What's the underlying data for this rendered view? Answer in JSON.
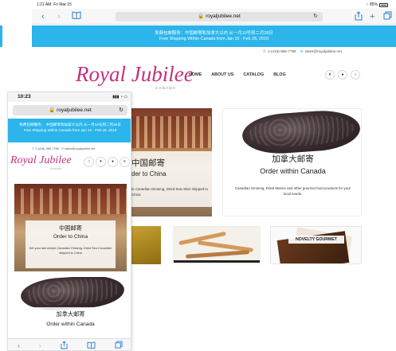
{
  "tablet": {
    "status": {
      "time": "1:21 AM",
      "date": "Fri Mar 15",
      "battery": "85%"
    },
    "toolbar": {
      "back_icon": "chevron-left-icon",
      "forward_icon": "chevron-right-icon",
      "bookmarks_icon": "book-icon",
      "url": "🔒 royaljubilee.net",
      "reload_icon": "reload-icon",
      "share_icon": "share-icon",
      "add_tab_icon": "plus-icon",
      "tabs_icon": "tabs-icon"
    },
    "banner": {
      "line1": "免费包邮服务：中国邮寄和加拿大以内 从一月10号到二月28日",
      "line2": "Free Shipping Within Canada from Jan 10 - Feb 28, 2019"
    },
    "contact": {
      "phone": "1-(416)-986-7788",
      "email": "sales@royaljubilee.net"
    },
    "logo": {
      "script": "Royal Jubilee",
      "sub": "CANADA"
    },
    "nav": [
      "HOME",
      "ABOUT US",
      "CATALOG",
      "BLOG"
    ],
    "cards": [
      {
        "title": "中国邮寄",
        "subtitle": "der to China",
        "desc": "te Canadian Ginseng, Dried Sea mber  shipped to China"
      },
      {
        "title": "加拿大邮寄",
        "subtitle": "Order within Canada",
        "desc": "Canadian Ginseng, Dried Marine and other gourmet food products for your local needs."
      }
    ],
    "products": {
      "gourmet_label": "NOVELTY GOURMET"
    }
  },
  "phone": {
    "status": {
      "time": "10:23"
    },
    "url": "🔒 royaljubilee.net",
    "banner": {
      "line1": "免费包邮服务：  中国邮寄和加拿大以内 从一月10号到二月28日",
      "line2": "Free Shipping Within Canada from Jan 10 - Feb 28, 2019"
    },
    "contact": {
      "phone": "1-(416)-986-7788",
      "email": "sales@royaljubilee.net"
    },
    "logo": {
      "script": "Royal Jubilee",
      "sub": "CANADA"
    },
    "cards": [
      {
        "title": "中国邮寄",
        "subtitle": "Order to China",
        "desc": "Get your last minute Canadian Ginseng, Dried Sea Cucumber  shipped to China"
      },
      {
        "title": "加拿大邮寄",
        "subtitle": "Order within Canada"
      }
    ]
  }
}
